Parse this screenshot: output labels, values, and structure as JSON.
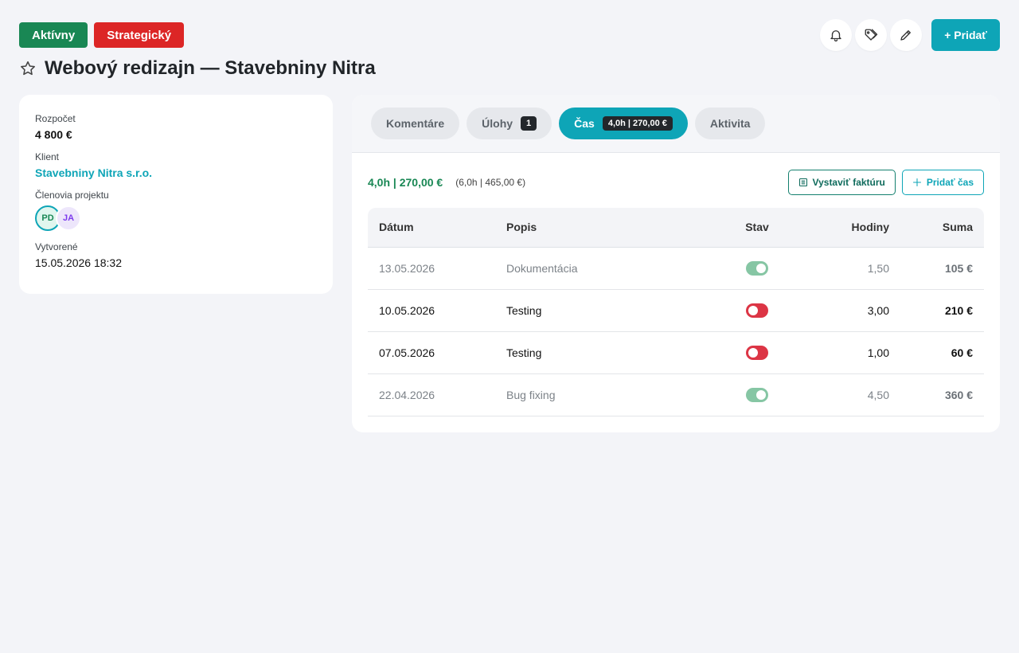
{
  "badges": {
    "status": "Aktívny",
    "type": "Strategický"
  },
  "actions": {
    "add_label": "+ Pridať",
    "icons": [
      "bell-icon",
      "tag-icon",
      "pencil-icon"
    ]
  },
  "title": "Webový redizajn — Stavebniny Nitra",
  "info": {
    "budget_label": "Rozpočet",
    "budget_value": "4 800 €",
    "client_label": "Klient",
    "client_value": "Stavebniny Nitra s.r.o.",
    "members_label": "Členovia projektu",
    "members": [
      "PD",
      "JA"
    ],
    "created_label": "Vytvorené",
    "created_value": "15.05.2026 18:32"
  },
  "tabs": [
    {
      "label": "Komentáre",
      "count": ""
    },
    {
      "label": "Úlohy",
      "count": "1"
    },
    {
      "label": "Čas",
      "count": "4,0h | 270,00 €"
    },
    {
      "label": "Aktivita",
      "count": ""
    }
  ],
  "summary": {
    "main": "4,0h | 270,00 €",
    "sub": "(6,0h | 465,00 €)",
    "invoice_label": "Vystaviť faktúru",
    "add_time_label": "Pridať čas"
  },
  "table": {
    "headers": [
      "Dátum",
      "Popis",
      "Stav",
      "Hodiny",
      "Suma"
    ],
    "rows": [
      {
        "date": "13.05.2026",
        "desc": "Dokumentácia",
        "billed": true,
        "hours": "1,50",
        "sum": "105 €"
      },
      {
        "date": "10.05.2026",
        "desc": "Testing",
        "billed": false,
        "hours": "3,00",
        "sum": "210 €"
      },
      {
        "date": "07.05.2026",
        "desc": "Testing",
        "billed": false,
        "hours": "1,00",
        "sum": "60 €"
      },
      {
        "date": "22.04.2026",
        "desc": "Bug fixing",
        "billed": true,
        "hours": "4,50",
        "sum": "360 €"
      }
    ]
  },
  "colors": {
    "accent": "#0ea5b7",
    "success": "#198754",
    "danger": "#dc2626"
  }
}
